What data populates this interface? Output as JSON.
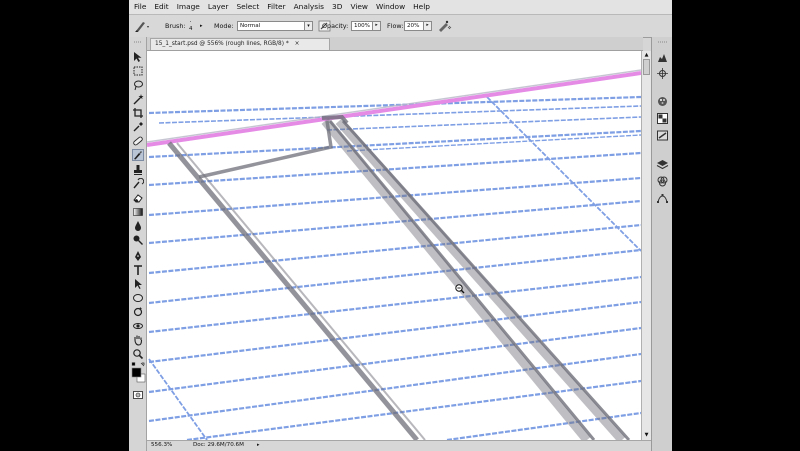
{
  "menu": [
    "File",
    "Edit",
    "Image",
    "Layer",
    "Select",
    "Filter",
    "Analysis",
    "3D",
    "View",
    "Window",
    "Help"
  ],
  "options_bar": {
    "brush_label": "Brush:",
    "brush_size": "4",
    "mode_label": "Mode:",
    "mode_value": "Normal",
    "opacity_label": "Opacity:",
    "opacity_value": "100%",
    "flow_label": "Flow:",
    "flow_value": "20%"
  },
  "document_tab": {
    "title": "15_1_start.psd @ 556% (rough lines, RGB/8)",
    "modified_marker": "*",
    "close_glyph": "×"
  },
  "status_bar": {
    "zoom": "556.3%",
    "doc_info": "Doc: 29.6M/70.6M"
  },
  "icons": {
    "active_tool": "brush-icon",
    "cursor": "zoom-out-cursor-icon"
  },
  "colors": {
    "guide_lines": "#7f9fe4",
    "top_edge": "#e58be6",
    "sketch_stroke": "#8a8a8a",
    "canvas_bg": "#ffffff"
  }
}
